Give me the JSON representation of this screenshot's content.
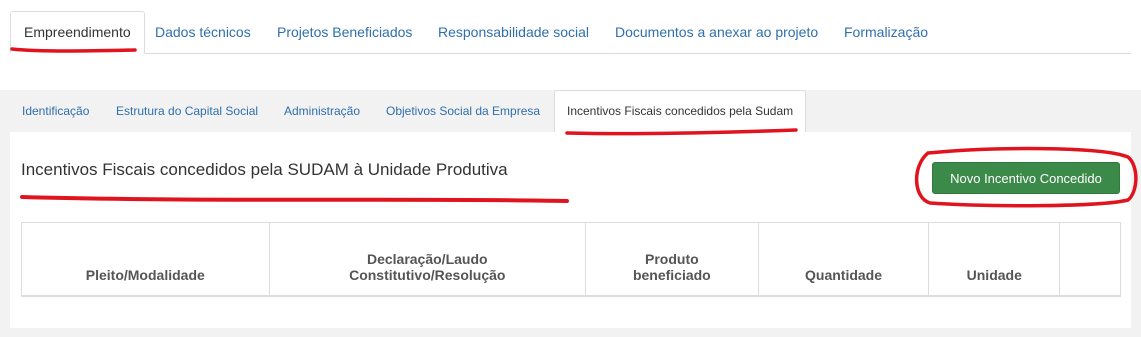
{
  "main_tabs": [
    {
      "label": "Empreendimento",
      "active": true
    },
    {
      "label": "Dados técnicos",
      "active": false
    },
    {
      "label": "Projetos Beneficiados",
      "active": false
    },
    {
      "label": "Responsabilidade social",
      "active": false
    },
    {
      "label": "Documentos a anexar ao projeto",
      "active": false
    },
    {
      "label": "Formalização",
      "active": false
    }
  ],
  "sub_tabs": [
    {
      "label": "Identificação",
      "active": false
    },
    {
      "label": "Estrutura do Capital Social",
      "active": false
    },
    {
      "label": "Administração",
      "active": false
    },
    {
      "label": "Objetivos Social da Empresa",
      "active": false
    },
    {
      "label": "Incentivos Fiscais concedidos pela Sudam",
      "active": true
    }
  ],
  "section": {
    "title": "Incentivos Fiscais concedidos pela SUDAM à Unidade Produtiva",
    "new_button_label": "Novo Incentivo Concedido"
  },
  "table": {
    "headers": [
      [
        "Pleito/Modalidade"
      ],
      [
        "Declaração/Laudo",
        "Constitutivo/Resolução"
      ],
      [
        "Produto",
        "beneficiado"
      ],
      [
        "Quantidade"
      ],
      [
        "Unidade"
      ],
      [
        ""
      ]
    ],
    "rows": []
  },
  "colors": {
    "link": "#2f6fad",
    "button_green": "#3b8a49",
    "annotation_red": "#e0141e"
  }
}
